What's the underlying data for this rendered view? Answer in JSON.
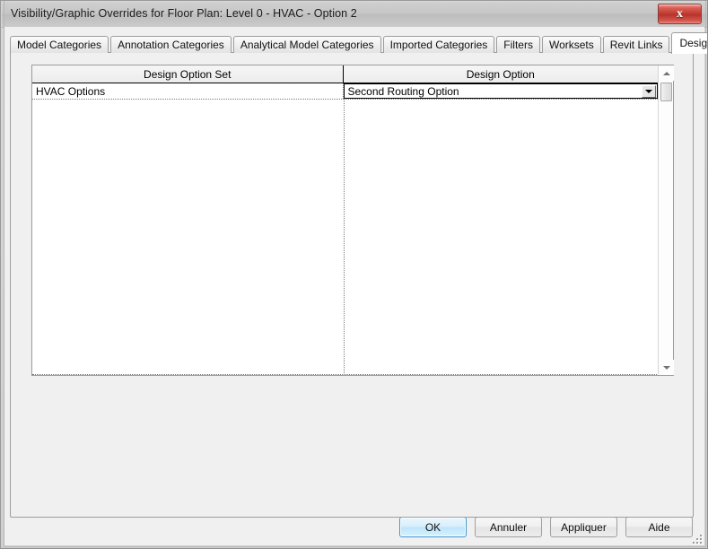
{
  "window": {
    "title": "Visibility/Graphic Overrides for Floor Plan: Level 0 - HVAC - Option 2",
    "close_label": "x",
    "close_icon": "close-icon"
  },
  "tabs": [
    {
      "label": "Model Categories",
      "selected": false
    },
    {
      "label": "Annotation Categories",
      "selected": false
    },
    {
      "label": "Analytical Model Categories",
      "selected": false
    },
    {
      "label": "Imported Categories",
      "selected": false
    },
    {
      "label": "Filters",
      "selected": false
    },
    {
      "label": "Worksets",
      "selected": false
    },
    {
      "label": "Revit Links",
      "selected": false
    },
    {
      "label": "Design Options",
      "selected": true
    }
  ],
  "grid": {
    "columns": [
      "Design Option Set",
      "Design Option"
    ],
    "rows": [
      {
        "design_option_set": "HVAC Options",
        "design_option": "Second Routing Option"
      }
    ],
    "scrollbar": {
      "up_icon": "scroll-up-arrow-icon",
      "down_icon": "scroll-down-arrow-icon"
    },
    "combo_icon": "chevron-down-icon"
  },
  "buttons": {
    "ok": "OK",
    "cancel": "Annuler",
    "apply": "Appliquer",
    "help": "Aide"
  },
  "colors": {
    "accent": "#3c96d0",
    "close_button": "#c03a31",
    "panel_bg": "#f0f0f0",
    "grid_bg": "#ffffff"
  }
}
